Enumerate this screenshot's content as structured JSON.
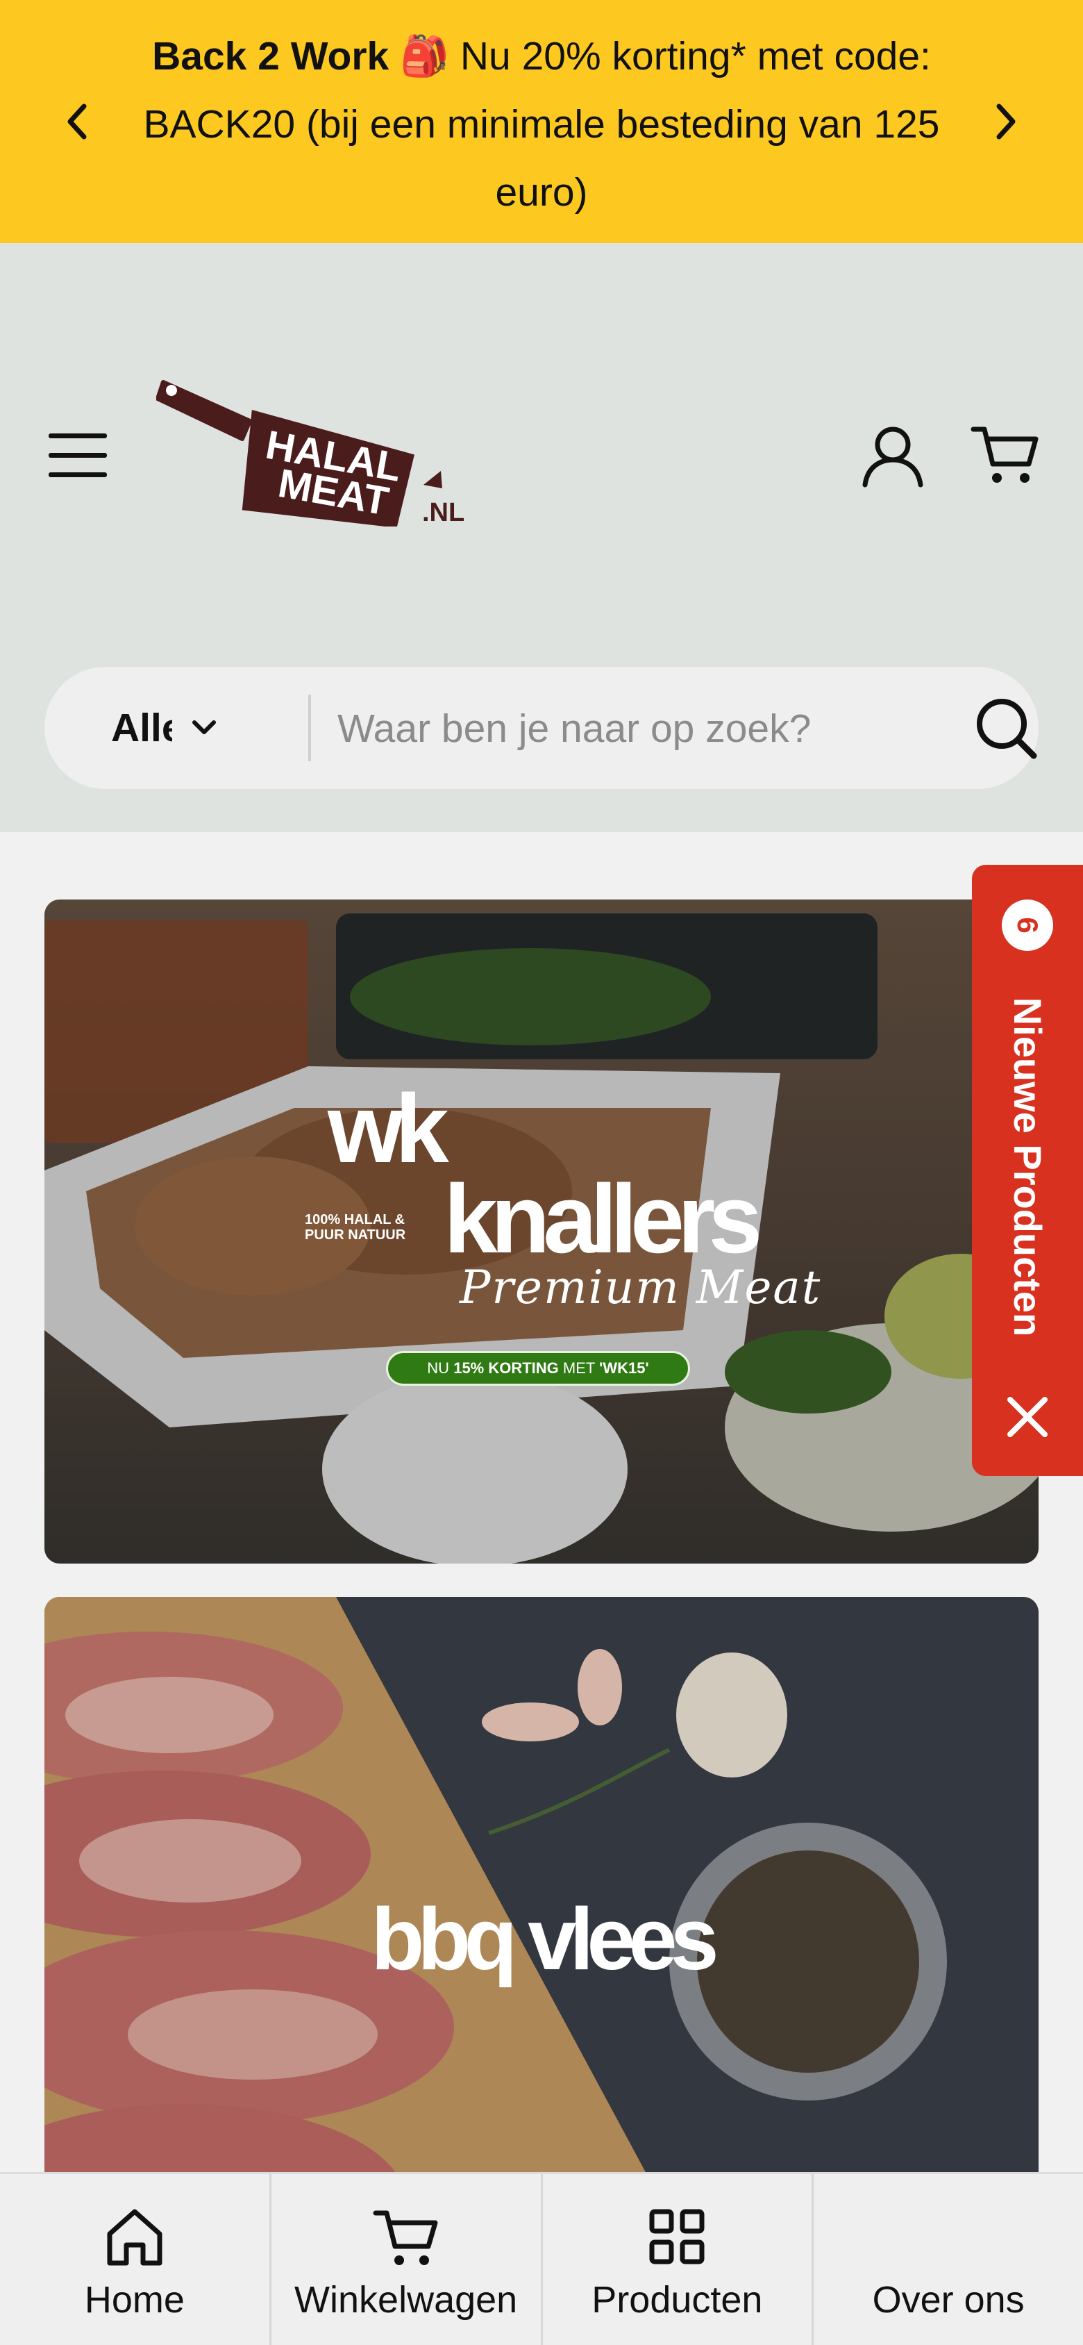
{
  "announcement": {
    "bold": "Back 2 Work",
    "emoji": "🎒",
    "text": "Nu 20% korting* met code: BACK20 (bij een minimale besteding van 125 euro)"
  },
  "header": {
    "logo_line1": "HALAL",
    "logo_line2": "MEAT",
    "logo_suffix": ".NL"
  },
  "search": {
    "category": "Alle",
    "placeholder": "Waar ben je naar op zoek?"
  },
  "banners": {
    "wk": {
      "title_line1": "wk",
      "title_line2": "knallers",
      "halal_line": "100% HALAL & PUUR NATUUR",
      "script": "Premium Meat",
      "promo_pre": "NU",
      "promo_bold": "15% KORTING",
      "promo_mid": "MET",
      "promo_code": "'WK15'"
    },
    "bbq": {
      "title": "bbq vlees"
    }
  },
  "new_products_tab": {
    "count": "6",
    "label": "Nieuwe Producten"
  },
  "bottom_nav": [
    {
      "label": "Home",
      "icon": "home-icon"
    },
    {
      "label": "Winkelwagen",
      "icon": "cart-icon"
    },
    {
      "label": "Producten",
      "icon": "grid-icon"
    },
    {
      "label": "Over ons",
      "icon": ""
    }
  ],
  "colors": {
    "announcement_bg": "#fdc820",
    "header_bg": "#dfe3df",
    "tab_red": "#d9311f",
    "promo_green": "#2f7a13",
    "logo_brown": "#4a1c1c"
  }
}
